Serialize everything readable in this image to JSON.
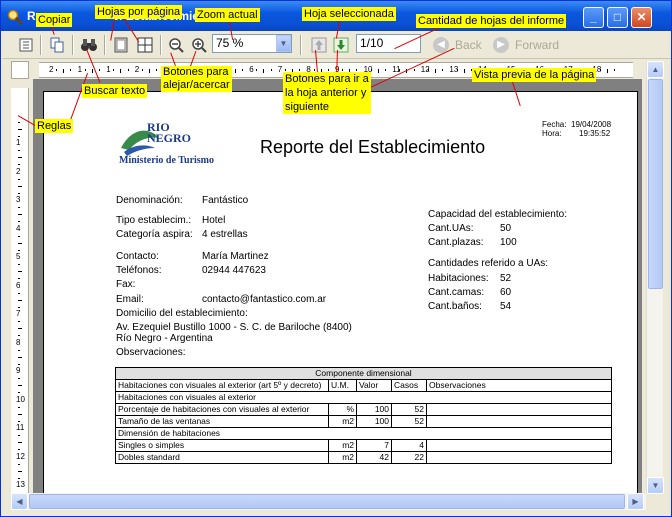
{
  "window": {
    "title": "Reporte del Establecimiento",
    "title_visible": "Re",
    "title_visible2": "el Establecimiento"
  },
  "toolbar": {
    "zoom_value": "75 %",
    "page_value": "1/10",
    "back_label": "Back",
    "forward_label": "Forward"
  },
  "annotations": {
    "copiar": "Copiar",
    "hojas_por_pagina": "Hojas por página",
    "zoom_actual": "Zoom actual",
    "hoja_seleccionada": "Hoja seleccionada",
    "cantidad_hojas": "Cantidad de hojas del informe",
    "buscar_texto": "Buscar texto",
    "botones_zoom_1": "Botones para",
    "botones_zoom_2": "alejar/acercar",
    "botones_hoja_1": "Botones para ir a",
    "botones_hoja_2": "la hoja anterior y",
    "botones_hoja_3": "siguiente",
    "vista_previa": "Vista previa de la página",
    "reglas": "Reglas"
  },
  "ruler": {
    "h_ticks": [
      "2",
      "1",
      "1",
      "2",
      "3",
      "4",
      "5",
      "6",
      "7",
      "8",
      "9",
      "10",
      "11",
      "12",
      "13",
      "14",
      "15",
      "16",
      "17",
      "18"
    ],
    "v_ticks": [
      "1",
      "2",
      "3",
      "4",
      "5",
      "6",
      "7",
      "8",
      "9",
      "10",
      "11",
      "12",
      "13"
    ]
  },
  "report": {
    "logo_line1": "RIO",
    "logo_line2": "NEGRO",
    "logo_line3": "Ministerio de Turismo",
    "title": "Reporte del Establecimiento",
    "fecha_label": "Fecha:",
    "fecha_value": "19/04/2008",
    "hora_label": "Hora:",
    "hora_value": "19:35:52",
    "denominacion_label": "Denominación:",
    "denominacion_value": "Fantástico",
    "tipo_label": "Tipo establecim.:",
    "tipo_value": "Hotel",
    "categoria_label": "Categoría aspira:",
    "categoria_value": "4 estrellas",
    "contacto_label": "Contacto:",
    "contacto_value": "María Martinez",
    "telefonos_label": "Teléfonos:",
    "telefonos_value": "02944 447623",
    "fax_label": "Fax:",
    "email_label": "Email:",
    "email_value": "contacto@fantastico.com.ar",
    "domicilio_label": "Domicilio del establecimiento:",
    "domicilio_line1": "Av. Ezequiel Bustillo 1000 - S. C. de Bariloche (8400)",
    "domicilio_line2": "Río Negro - Argentina",
    "observaciones_label": "Observaciones:",
    "capacidad_title": "Capacidad del establecimiento:",
    "cant_uas_label": "Cant.UAs:",
    "cant_uas_value": "50",
    "cant_plazas_label": "Cant.plazas:",
    "cant_plazas_value": "100",
    "cantidades_title": "Cantidades referido a UAs:",
    "habitaciones_label": "Habitaciones:",
    "habitaciones_value": "52",
    "camas_label": "Cant.camas:",
    "camas_value": "60",
    "banos_label": "Cant.baños:",
    "banos_value": "54"
  },
  "table": {
    "title": "Componente dimensional",
    "headers": [
      "Habitaciones con visuales al exterior (art 5º y decreto)",
      "U.M.",
      "Valor",
      "Casos",
      "Observaciones"
    ],
    "section1": "Habitaciones con visuales al exterior",
    "rows1": [
      {
        "name": "Porcentaje de habitaciones con visuales al exterior",
        "um": "%",
        "valor": "100",
        "casos": "52",
        "obs": ""
      },
      {
        "name": "Tamaño de las ventanas",
        "um": "m2",
        "valor": "100",
        "casos": "52",
        "obs": ""
      }
    ],
    "section2": "Dimensión de habitaciones",
    "rows2": [
      {
        "name": "Singles o simples",
        "um": "m2",
        "valor": "7",
        "casos": "4",
        "obs": ""
      },
      {
        "name": "Dobles standard",
        "um": "m2",
        "valor": "42",
        "casos": "22",
        "obs": ""
      }
    ]
  }
}
